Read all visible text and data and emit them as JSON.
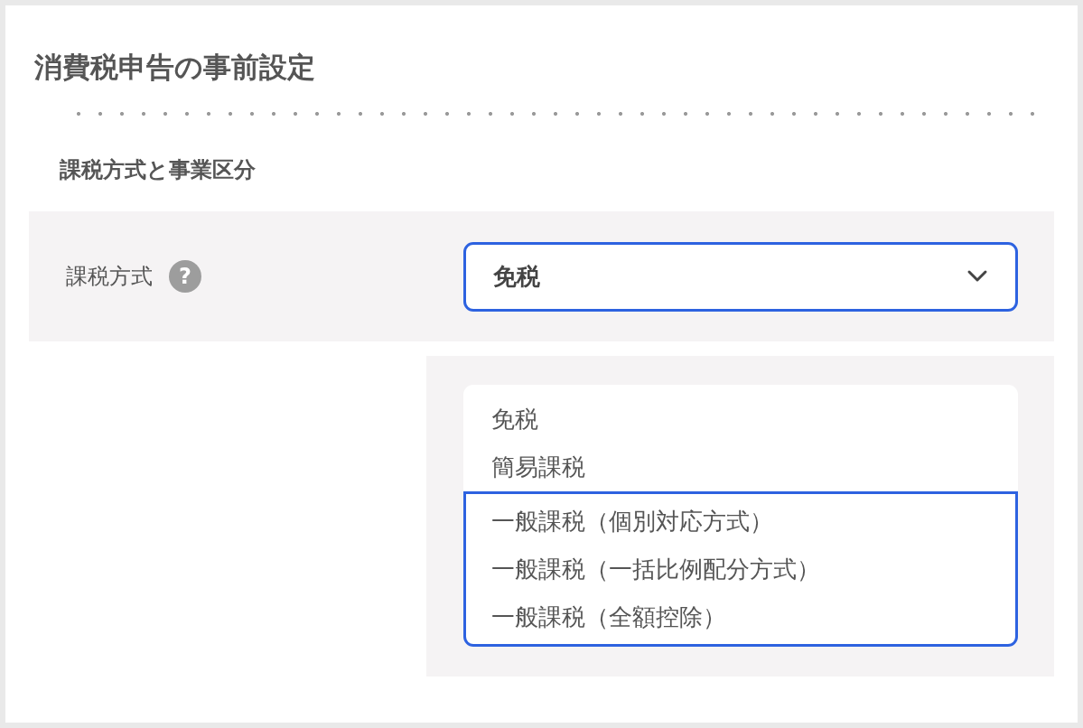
{
  "title": "消費税申告の事前設定",
  "section": {
    "heading": "課税方式と事業区分"
  },
  "field": {
    "label": "課税方式",
    "help": "?",
    "value": "免税",
    "expanded": true
  },
  "options": [
    {
      "label": "免税",
      "highlighted": false
    },
    {
      "label": "簡易課税",
      "highlighted": false
    },
    {
      "label": "一般課税（個別対応方式）",
      "highlighted": true
    },
    {
      "label": "一般課税（一括比例配分方式）",
      "highlighted": true
    },
    {
      "label": "一般課税（全額控除）",
      "highlighted": true
    }
  ]
}
